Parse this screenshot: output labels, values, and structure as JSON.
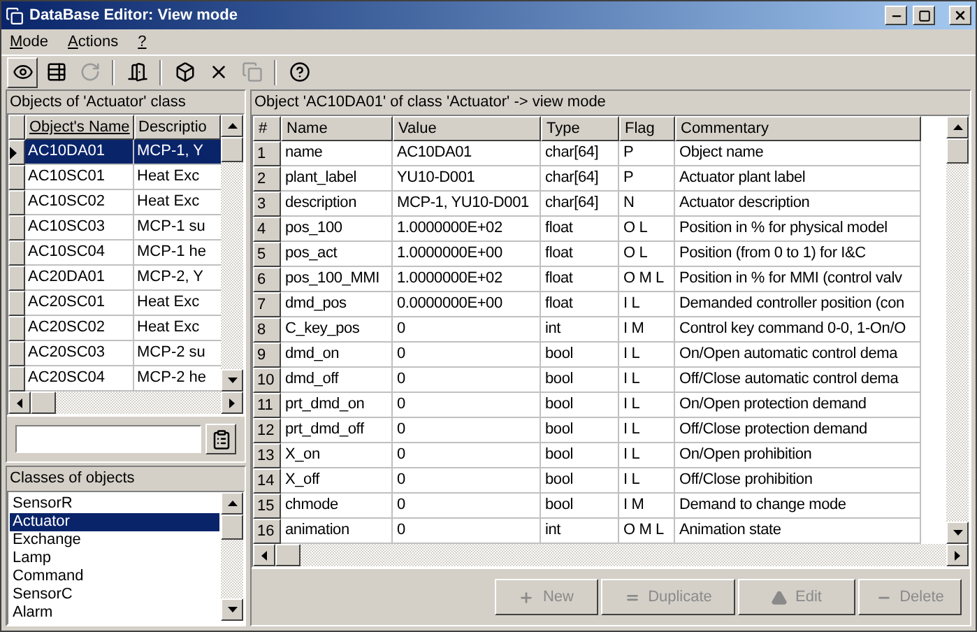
{
  "window": {
    "title": "DataBase Editor: View mode"
  },
  "menu": [
    "Mode",
    "Actions",
    "?"
  ],
  "toolbar": [
    {
      "kind": "view",
      "disabled": false
    },
    {
      "kind": "table",
      "disabled": false
    },
    {
      "kind": "refresh",
      "disabled": true
    },
    {
      "kind": "sep"
    },
    {
      "kind": "exit",
      "disabled": false
    },
    {
      "kind": "sep"
    },
    {
      "kind": "cube",
      "disabled": false
    },
    {
      "kind": "cross",
      "disabled": false
    },
    {
      "kind": "copy",
      "disabled": true
    },
    {
      "kind": "sep"
    },
    {
      "kind": "help",
      "disabled": false
    }
  ],
  "objects_panel": {
    "title": "Objects of 'Actuator' class",
    "columns": [
      "Object's Name",
      "Descriptio"
    ],
    "rows": [
      {
        "name": "AC10DA01",
        "description": "MCP-1, Y",
        "selected": true
      },
      {
        "name": "AC10SC01",
        "description": "Heat Exc",
        "selected": false
      },
      {
        "name": "AC10SC02",
        "description": "Heat Exc",
        "selected": false
      },
      {
        "name": "AC10SC03",
        "description": "MCP-1 su",
        "selected": false
      },
      {
        "name": "AC10SC04",
        "description": "MCP-1 he",
        "selected": false
      },
      {
        "name": "AC20DA01",
        "description": "MCP-2, Y",
        "selected": false
      },
      {
        "name": "AC20SC01",
        "description": "Heat Exc",
        "selected": false
      },
      {
        "name": "AC20SC02",
        "description": "Heat Exc",
        "selected": false
      },
      {
        "name": "AC20SC03",
        "description": "MCP-2 su",
        "selected": false
      },
      {
        "name": "AC20SC04",
        "description": "MCP-2 he",
        "selected": false
      }
    ]
  },
  "classes_panel": {
    "title": "Classes of objects",
    "items": [
      {
        "label": "SensorR",
        "selected": false
      },
      {
        "label": "Actuator",
        "selected": true
      },
      {
        "label": "Exchange",
        "selected": false
      },
      {
        "label": "Lamp",
        "selected": false
      },
      {
        "label": "Command",
        "selected": false
      },
      {
        "label": "SensorC",
        "selected": false
      },
      {
        "label": "Alarm",
        "selected": false
      }
    ]
  },
  "object_panel": {
    "title": "Object 'AC10DA01' of class 'Actuator' -> view mode",
    "columns": [
      "#",
      "Name",
      "Value",
      "Type",
      "Flag",
      "Commentary"
    ],
    "rows": [
      [
        "1",
        "name",
        "AC10DA01",
        "char[64]",
        "P",
        "Object name"
      ],
      [
        "2",
        "plant_label",
        "YU10-D001",
        "char[64]",
        "P",
        "Actuator plant label"
      ],
      [
        "3",
        "description",
        "MCP-1, YU10-D001",
        "char[64]",
        "N",
        "Actuator description"
      ],
      [
        "4",
        "pos_100",
        "1.0000000E+02",
        "float",
        "O L",
        "Position in % for physical model"
      ],
      [
        "5",
        "pos_act",
        "1.0000000E+00",
        "float",
        "O L",
        "Position (from 0 to 1) for I&C"
      ],
      [
        "6",
        "pos_100_MMI",
        "1.0000000E+02",
        "float",
        "O M L",
        "Position in % for MMI (control valv"
      ],
      [
        "7",
        "dmd_pos",
        "0.0000000E+00",
        "float",
        "I L",
        "Demanded controller position (con"
      ],
      [
        "8",
        "C_key_pos",
        "0",
        "int",
        "I M",
        "Control key command 0-0, 1-On/O"
      ],
      [
        "9",
        "dmd_on",
        "0",
        "bool",
        "I L",
        "On/Open automatic control dema"
      ],
      [
        "10",
        "dmd_off",
        "0",
        "bool",
        "I L",
        "Off/Close automatic control dema"
      ],
      [
        "11",
        "prt_dmd_on",
        "0",
        "bool",
        "I L",
        "On/Open protection demand"
      ],
      [
        "12",
        "prt_dmd_off",
        "0",
        "bool",
        "I L",
        "Off/Close protection demand"
      ],
      [
        "13",
        "X_on",
        "0",
        "bool",
        "I L",
        "On/Open prohibition"
      ],
      [
        "14",
        "X_off",
        "0",
        "bool",
        "I L",
        "Off/Close prohibition"
      ],
      [
        "15",
        "chmode",
        "0",
        "bool",
        "I M",
        "Demand to change mode"
      ],
      [
        "16",
        "animation",
        "0",
        "int",
        "O M L",
        "Animation state"
      ]
    ]
  },
  "buttons": [
    {
      "kind": "new",
      "label": "New",
      "disabled": true
    },
    {
      "kind": "duplicate",
      "label": "Duplicate",
      "disabled": true
    },
    {
      "kind": "edit",
      "label": "Edit",
      "disabled": true
    },
    {
      "kind": "delete",
      "label": "Delete",
      "disabled": true
    }
  ]
}
